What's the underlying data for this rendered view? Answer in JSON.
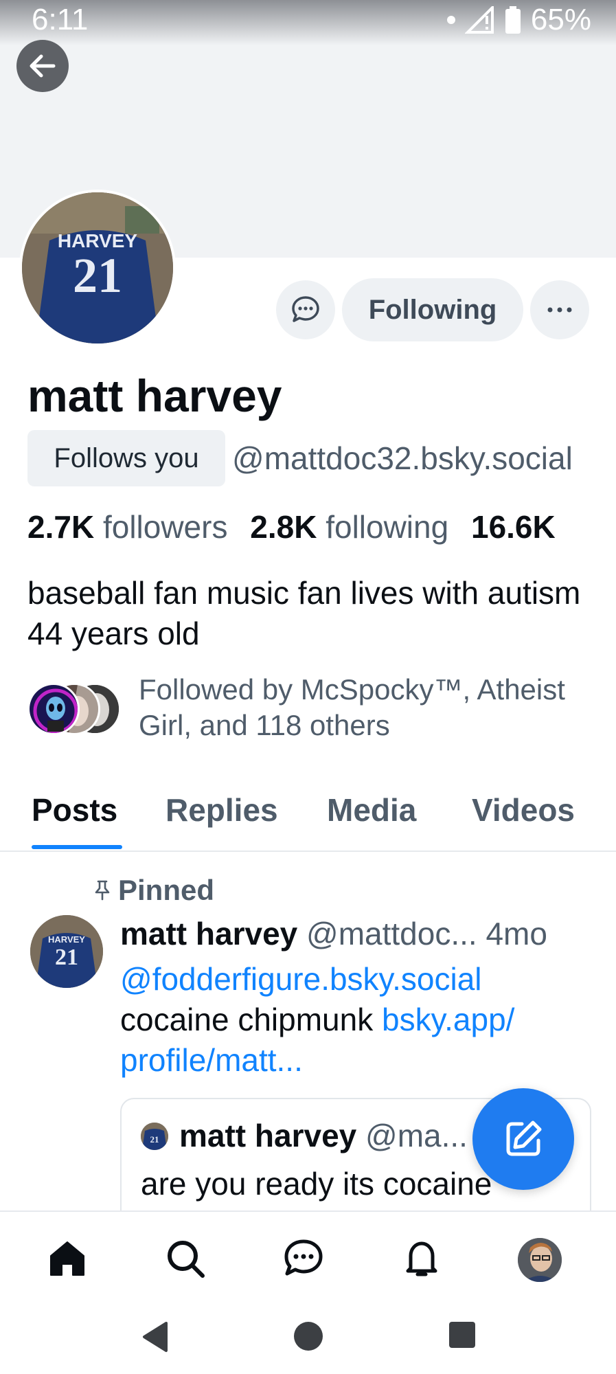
{
  "status_bar": {
    "time": "6:11",
    "battery": "65%",
    "icons": [
      "dot-icon",
      "signal-icon",
      "battery-icon"
    ]
  },
  "header": {
    "back_icon": "arrow-left-icon"
  },
  "profile": {
    "display_name": "matt harvey",
    "follows_you": "Follows you",
    "handle": "@mattdoc32.bsky.social",
    "avatar_jersey_name": "HARVEY",
    "avatar_jersey_number": "21",
    "stats": {
      "followers_count": "2.7K",
      "followers_label": "followers",
      "following_count": "2.8K",
      "following_label": "following",
      "posts_count": "16.6K"
    },
    "bio": "baseball fan music fan lives with autism 44 years old",
    "followed_by": "Followed by McSpocky™, Atheist Girl, and 118 others"
  },
  "actions": {
    "message_icon": "chat-bubble-icon",
    "following_label": "Following",
    "more_icon": "ellipsis-icon"
  },
  "tabs": [
    {
      "label": "Posts",
      "active": true
    },
    {
      "label": "Replies",
      "active": false
    },
    {
      "label": "Media",
      "active": false
    },
    {
      "label": "Videos",
      "active": false
    }
  ],
  "pinned_post": {
    "pinned_label": "Pinned",
    "author_name": "matt harvey",
    "author_handle": "@mattdoc...",
    "time": "4mo",
    "mention": "@fodderfigure.bsky.social",
    "text": "cocaine chipmunk",
    "link_part1": "bsky.app/",
    "link_part2": "profile/matt...",
    "quote": {
      "author_name": "matt harvey",
      "author_handle": "@ma...",
      "text": "are you ready its cocaine"
    }
  },
  "fab": {
    "icon": "compose-icon"
  },
  "bottom_nav": [
    "home-icon",
    "search-icon",
    "chat-icon",
    "bell-icon",
    "profile-avatar"
  ],
  "colors": {
    "accent": "#1083fe",
    "fab": "#1f7cf0",
    "muted_text": "#4f5c6a",
    "button_bg": "#eef1f4"
  }
}
